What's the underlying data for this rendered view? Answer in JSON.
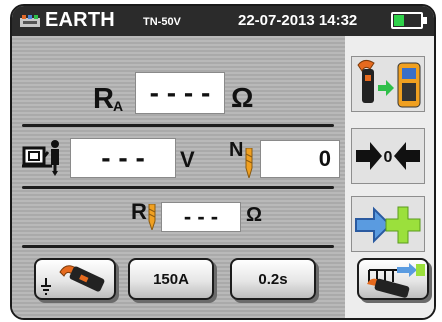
{
  "header": {
    "title": "EARTH",
    "subtitle": "TN-50V",
    "datetime": "22-07-2013 14:32",
    "battery_level": 0.4
  },
  "measurements": {
    "ra": {
      "label": "R",
      "subscript": "A",
      "value": "- - - -",
      "unit": "Ω"
    },
    "voltage": {
      "value": "- - -",
      "unit": "V"
    },
    "n": {
      "label": "N",
      "value": "0"
    },
    "rj": {
      "label": "R",
      "value": "- - -",
      "unit": "Ω"
    }
  },
  "buttons": {
    "current": "150A",
    "time": "0.2s"
  },
  "icons": {
    "header": "earth-device-icon",
    "sidebar": [
      "clamp-transfer-icon",
      "zero-calibration-icon",
      "add-arrow-icon"
    ],
    "bottom": [
      "earth-clamp-icon",
      "clamp-connection-icon"
    ]
  },
  "colors": {
    "header_bg": "#2b2b2b",
    "battery": "#2fd24a",
    "arrow_blue": "#5a9be0",
    "plus_green": "#9be03c",
    "clamp_orange": "#e66a1e"
  }
}
